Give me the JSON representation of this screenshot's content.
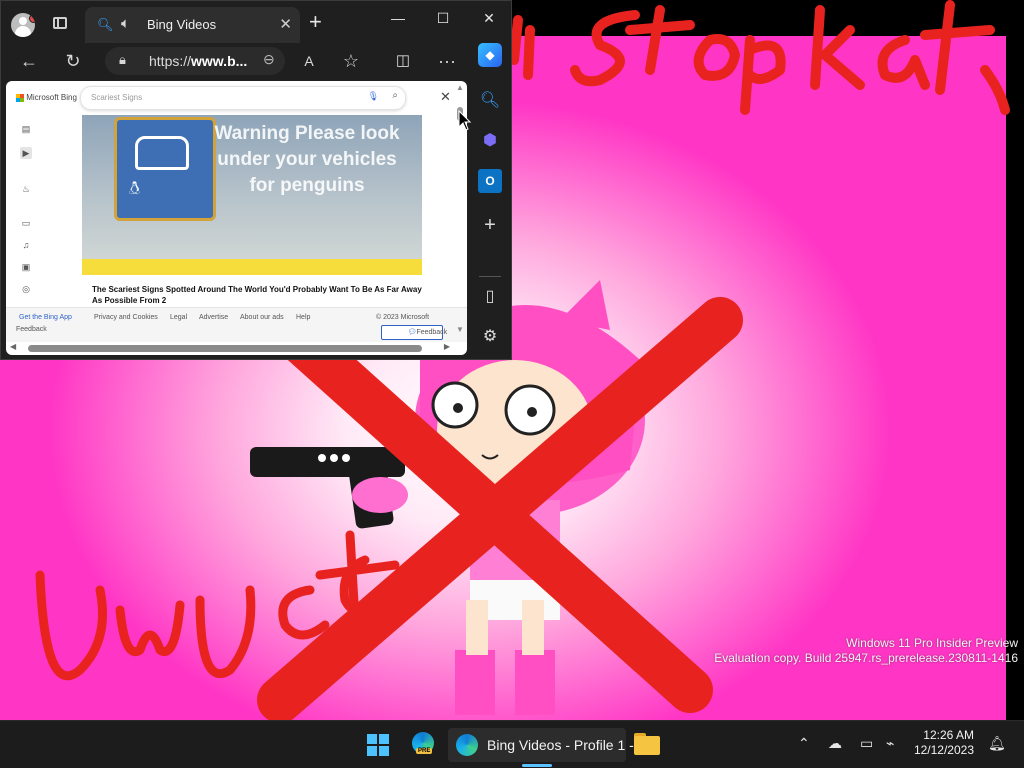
{
  "wallpaper": {
    "top_scribble": "I stop kat",
    "bottom_scribble": "UwU cat",
    "watermark_line1": "Windows 11 Pro Insider Preview",
    "watermark_line2": "Evaluation copy. Build 25947.rs_prerelease.230811-1416"
  },
  "browser": {
    "tab_title": "Bing Videos",
    "tab_close": "✕",
    "new_tab": "+",
    "minimize": "—",
    "maximize": "☐",
    "close": "✕",
    "url_prefix": "https://",
    "url_host": "www.b...",
    "more": "···"
  },
  "page": {
    "logo_text": "Microsoft Bing",
    "search_placeholder": "Scariest Signs",
    "video_sign_text": "Warning Please look under your vehicles for penguins",
    "video_caption": "The Scariest Signs Spotted Around The World You'd Probably Want To Be As Far Away As Possible From 2",
    "footer": {
      "get_app": "Get the Bing App",
      "privacy": "Privacy and Cookies",
      "legal": "Legal",
      "advertise": "Advertise",
      "about_ads": "About our ads",
      "help": "Help",
      "copyright": "© 2023 Microsoft",
      "feedback_link": "Feedback",
      "feedback_button": "Feedback"
    }
  },
  "taskbar": {
    "active_app_label": "Bing Videos - Profile 1 -",
    "edge_badge": "PRE",
    "time": "12:26 AM",
    "date": "12/12/2023"
  },
  "colors": {
    "accent": "#4cc2ff",
    "scribble": "#e8231f",
    "wallpaper_pink": "#ff36c5"
  }
}
